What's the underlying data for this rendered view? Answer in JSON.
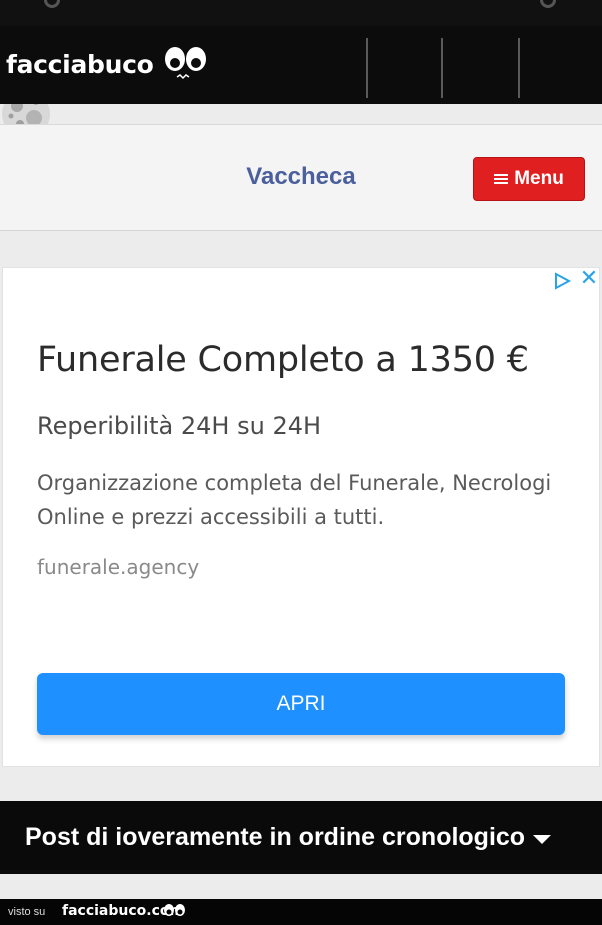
{
  "header": {
    "logo_text": "facciabuco",
    "icons": [
      "search-icon",
      "mail-icon",
      "moon-avatar",
      "hamburger-icon"
    ]
  },
  "page": {
    "title": "Vaccheca",
    "menu_label": "Menu"
  },
  "ad": {
    "headline": "Funerale Completo a 1350 €",
    "subheadline": "Reperibilità 24H su 24H",
    "body": "Organizzazione completa del Funerale, Necrologi Online e prezzi accessibili a tutti.",
    "domain": "funerale.agency",
    "cta_label": "APRI",
    "cta_color": "#1e90ff"
  },
  "posts_bar": {
    "label": "Post di ioveramente in ordine cronologico"
  },
  "footer": {
    "seen_on": "visto su",
    "brand": "facciabuco.com"
  },
  "colors": {
    "brand_red": "#e01f21",
    "title_blue": "#4a5f9c",
    "bar_black": "#0c0c0c"
  }
}
